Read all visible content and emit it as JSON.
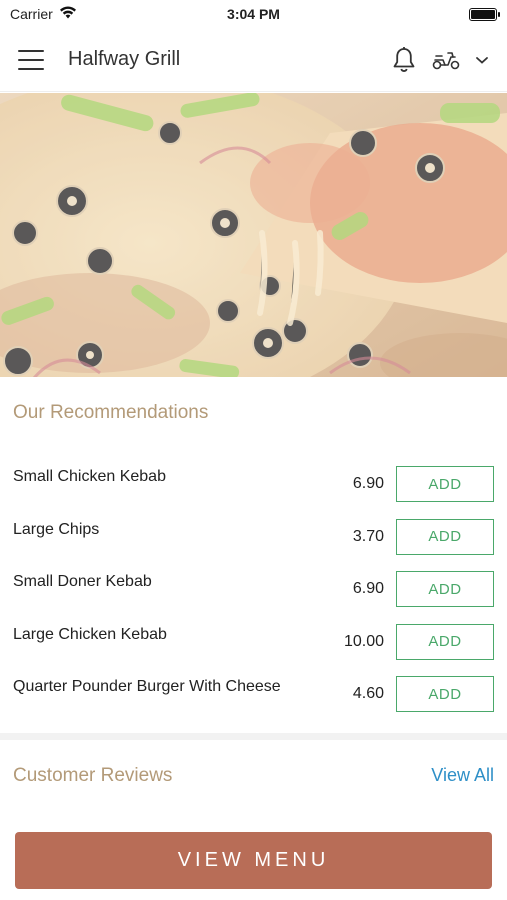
{
  "status_bar": {
    "carrier": "Carrier",
    "time": "3:04 PM"
  },
  "header": {
    "title": "Halfway Grill"
  },
  "recommendations": {
    "title": "Our Recommendations",
    "items": [
      {
        "name": "Small Chicken Kebab",
        "price": "6.90",
        "add_label": "ADD"
      },
      {
        "name": "Large Chips",
        "price": "3.70",
        "add_label": "ADD"
      },
      {
        "name": "Small Doner Kebab",
        "price": "6.90",
        "add_label": "ADD"
      },
      {
        "name": "Large Chicken Kebab",
        "price": "10.00",
        "add_label": "ADD"
      },
      {
        "name": "Quarter Pounder Burger With Cheese",
        "price": "4.60",
        "add_label": "ADD"
      }
    ]
  },
  "reviews": {
    "title": "Customer Reviews",
    "view_all_label": "View All"
  },
  "footer": {
    "view_menu_label": "VIEW MENU"
  },
  "colors": {
    "section_title": "#b39a78",
    "add_button": "#4aa86a",
    "view_all_link": "#2e8fc7",
    "view_menu_button": "#b86d57"
  }
}
